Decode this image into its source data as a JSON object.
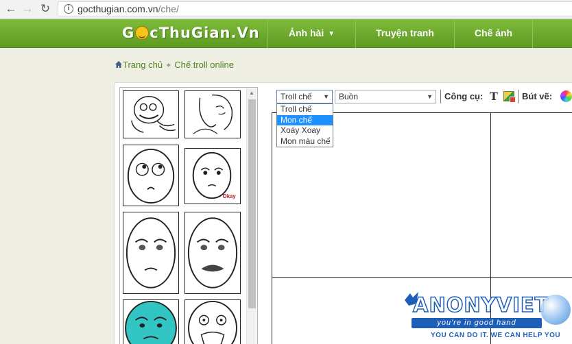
{
  "browser": {
    "back_icon": "arrow-left",
    "forward_icon": "arrow-right",
    "reload_icon": "reload",
    "url_host": "gocthugian.com.vn",
    "url_path": "/che/"
  },
  "site": {
    "logo_prefix": "G",
    "logo_suffix": "cThuGian.Vn",
    "menu": [
      {
        "label": "Ảnh hài",
        "has_caret": true
      },
      {
        "label": "Truyện tranh"
      },
      {
        "label": "Chế ảnh"
      }
    ],
    "colors": {
      "header_green": "#6aa82b",
      "link_green": "#508820",
      "highlight_blue": "#1e90ff"
    }
  },
  "breadcrumb": {
    "home": "Trang chủ",
    "current": "Chế troll online"
  },
  "toolbar": {
    "category_selected": "Troll chế",
    "subcategory_selected": "Buồn",
    "tools_label": "Công cụ:",
    "pen_label": "Bút vẽ:",
    "category_options": [
      "Troll chế",
      "Mon chế",
      "Xoáy Xoay",
      "Mon màu chế"
    ],
    "highlighted_option": "Mon chế"
  },
  "stickers": [
    {
      "name": "troll-face-shrug"
    },
    {
      "name": "hug-face"
    },
    {
      "name": "thinking-face"
    },
    {
      "name": "okay-face",
      "caption": "Okay"
    },
    {
      "name": "sad-face-1"
    },
    {
      "name": "sad-face-mustache"
    },
    {
      "name": "cyan-face"
    },
    {
      "name": "yelling-face"
    }
  ],
  "watermark": {
    "title": "ANONYVIET",
    "tagline": "you're in good hand",
    "slogan": "YOU CAN DO IT. WE CAN HELP YOU"
  }
}
